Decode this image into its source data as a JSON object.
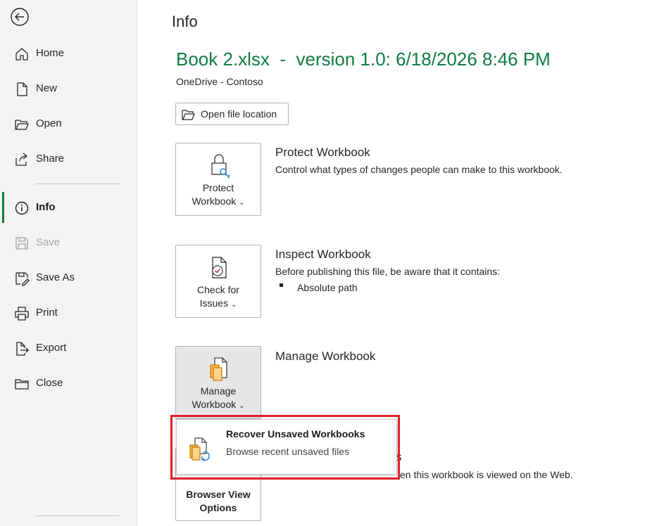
{
  "sidebar": {
    "items": [
      {
        "label": "Home"
      },
      {
        "label": "New"
      },
      {
        "label": "Open"
      },
      {
        "label": "Share"
      },
      {
        "label": "Info"
      },
      {
        "label": "Save"
      },
      {
        "label": "Save As"
      },
      {
        "label": "Print"
      },
      {
        "label": "Export"
      },
      {
        "label": "Close"
      }
    ],
    "active_item": "Info",
    "disabled_item": "Save"
  },
  "main": {
    "title": "Info",
    "file_heading": "Book 2.xlsx  -  version 1.0: 6/18/2026 8:46 PM",
    "location": "OneDrive - Contoso",
    "open_location_label": "Open file location",
    "protect": {
      "button_line1": "Protect",
      "button_line2": "Workbook",
      "title": "Protect Workbook",
      "description": "Control what types of changes people can make to this workbook."
    },
    "inspect": {
      "button_line1": "Check for",
      "button_line2": "Issues",
      "title": "Inspect Workbook",
      "description": "Before publishing this file, be aware that it contains:",
      "bullet": "Absolute path"
    },
    "manage": {
      "button_line1": "Manage",
      "button_line2": "Workbook",
      "title": "Manage Workbook"
    },
    "browser_view": {
      "button_line1": "Browser View",
      "button_line2": "Options",
      "partial_title": "s",
      "partial_description": "en this workbook is viewed on the Web."
    },
    "dropdown": {
      "title": "Recover Unsaved Workbooks",
      "description": "Browse recent unsaved files"
    }
  },
  "colors": {
    "accent": "#107c41",
    "highlight": "#e0202b",
    "sidebar_bg": "#f3f3f3"
  },
  "icons": [
    "back-arrow-icon",
    "home-icon",
    "new-document-icon",
    "open-folder-icon",
    "share-icon",
    "info-icon",
    "save-icon",
    "save-as-icon",
    "print-icon",
    "export-icon",
    "close-folder-icon",
    "folder-open-icon",
    "lock-key-icon",
    "document-check-icon",
    "manage-documents-icon",
    "recover-documents-icon"
  ]
}
